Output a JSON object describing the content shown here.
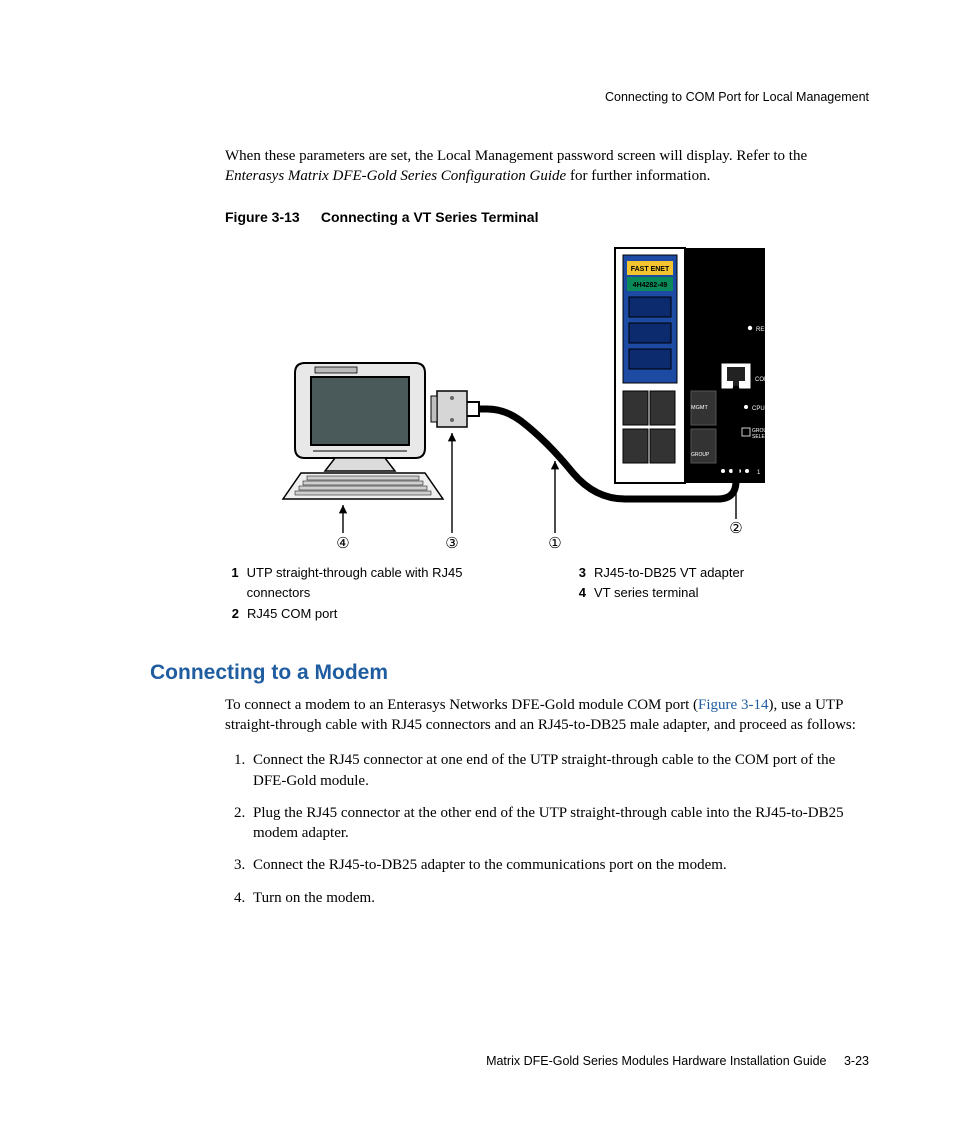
{
  "header": {
    "running_head": "Connecting to COM Port for Local Management"
  },
  "intro": {
    "line1": "When these parameters are set, the Local Management password screen will display. Refer to the ",
    "italic": "Enterasys Matrix DFE-Gold Series Configuration Guide",
    "line2": " for further information."
  },
  "figure": {
    "label": "Figure 3-13",
    "title": "Connecting a VT Series Terminal",
    "module": {
      "top_label": "FAST ENET",
      "model": "4H4282-49",
      "lbl_reset": "RESET",
      "lbl_com": "COM",
      "lbl_mgmt": "MGMT",
      "lbl_cpu": "CPU",
      "lbl_group": "GROUP",
      "lbl_group_select_a": "GROUP",
      "lbl_group_select_b": "SELECT",
      "lbl_one": "1"
    },
    "callouts": {
      "c1": "①",
      "c2": "②",
      "c3": "③",
      "c4": "④"
    }
  },
  "legend": {
    "left": [
      {
        "n": "1",
        "t": "UTP straight-through cable with RJ45 connectors"
      },
      {
        "n": "2",
        "t": "RJ45 COM port"
      }
    ],
    "right": [
      {
        "n": "3",
        "t": "RJ45-to-DB25 VT adapter"
      },
      {
        "n": "4",
        "t": "VT series terminal"
      }
    ]
  },
  "section": {
    "heading": "Connecting to a Modem",
    "p_pre": "To connect a modem to an Enterasys Networks DFE-Gold module COM port (",
    "p_link": "Figure 3-14",
    "p_post": "), use a UTP straight-through cable with RJ45 connectors and an RJ45-to-DB25 male adapter, and proceed as follows:",
    "steps": [
      "Connect the RJ45 connector at one end of the UTP straight-through cable to the COM port of the DFE-Gold module.",
      "Plug the RJ45 connector at the other end of the UTP straight-through cable into the RJ45-to-DB25 modem adapter.",
      "Connect the RJ45-to-DB25 adapter to the communications port on the modem.",
      "Turn on the modem."
    ]
  },
  "footer": {
    "doc": "Matrix DFE-Gold Series Modules Hardware Installation Guide",
    "page": "3-23"
  }
}
